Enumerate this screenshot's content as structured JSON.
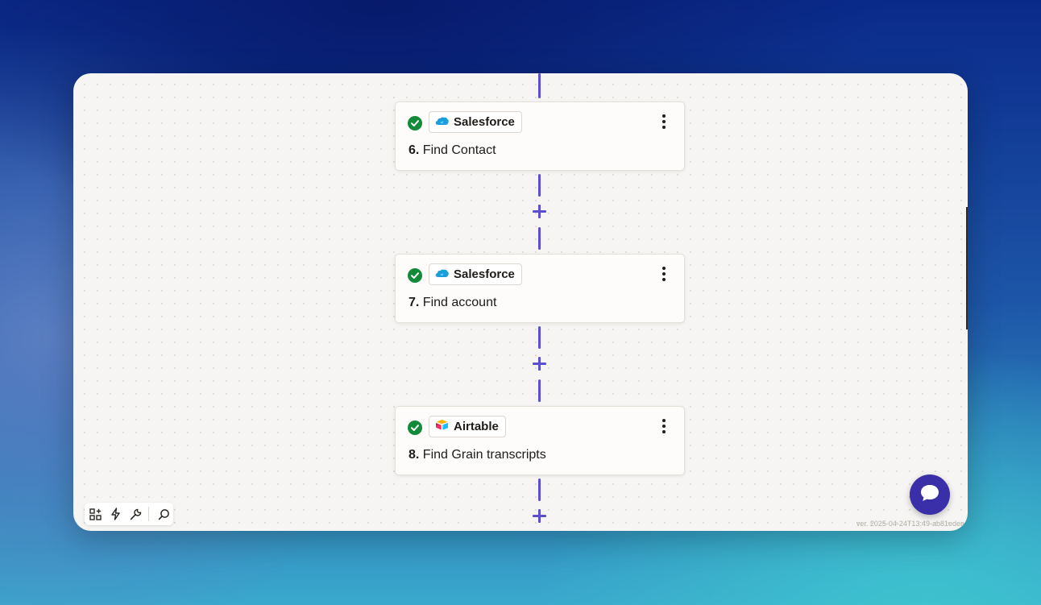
{
  "steps": [
    {
      "number": "6.",
      "title": "Find Contact",
      "app": "Salesforce",
      "app_icon": "salesforce-icon",
      "status": "success"
    },
    {
      "number": "7.",
      "title": "Find account",
      "app": "Salesforce",
      "app_icon": "salesforce-icon",
      "status": "success"
    },
    {
      "number": "8.",
      "title": "Find Grain transcripts",
      "app": "Airtable",
      "app_icon": "airtable-icon",
      "status": "success"
    }
  ],
  "toolbar": {
    "icons": [
      "apps-add-icon",
      "lightning-icon",
      "wrench-icon",
      "search-icon"
    ]
  },
  "version": "ver. 2025-04-24T13:49-ab81edea",
  "colors": {
    "accent": "#5b4fcf",
    "success": "#138a3a",
    "chat": "#3a2fa8",
    "canvas": "#f6f5f3"
  }
}
